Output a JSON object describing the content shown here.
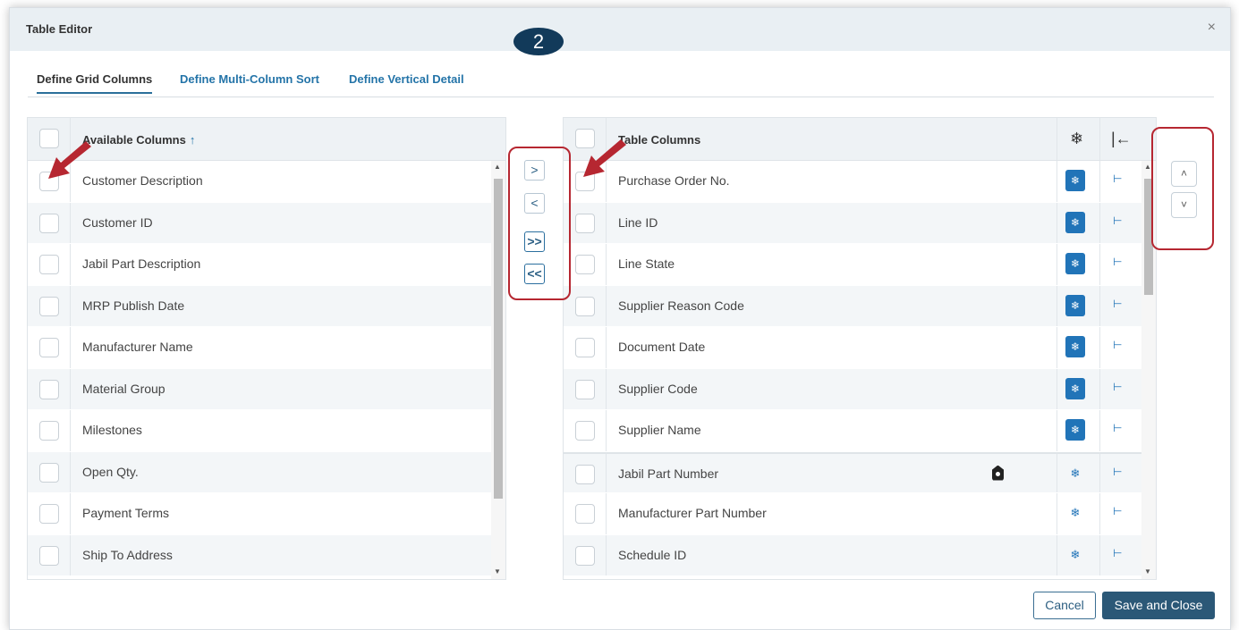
{
  "dialog": {
    "title": "Table Editor",
    "close_glyph": "×",
    "step_badge": "2"
  },
  "tabs": [
    {
      "label": "Define Grid Columns",
      "active": true
    },
    {
      "label": "Define Multi-Column Sort",
      "active": false
    },
    {
      "label": "Define Vertical Detail",
      "active": false
    }
  ],
  "available": {
    "header": "Available Columns",
    "sort_glyph": "↑",
    "items": [
      "Customer Description",
      "Customer ID",
      "Jabil Part Description",
      "MRP Publish Date",
      "Manufacturer Name",
      "Material Group",
      "Milestones",
      "Open Qty.",
      "Payment Terms",
      "Ship To Address"
    ]
  },
  "transfer": {
    "move_right": ">",
    "move_left": "<",
    "move_all_right": ">>",
    "move_all_left": "<<"
  },
  "table_columns": {
    "header": "Table Columns",
    "freeze_header_icon": "snowflake-icon",
    "pin_header_icon": "pin-left-icon",
    "freeze_glyph": "❄",
    "pin_glyph": "⊢",
    "items": [
      {
        "label": "Purchase Order No.",
        "frozen": true
      },
      {
        "label": "Line ID",
        "frozen": true
      },
      {
        "label": "Line State",
        "frozen": true
      },
      {
        "label": "Supplier Reason Code",
        "frozen": true
      },
      {
        "label": "Document Date",
        "frozen": true
      },
      {
        "label": "Supplier Code",
        "frozen": true
      },
      {
        "label": "Supplier Name",
        "frozen": true
      },
      {
        "label": "Jabil Part Number",
        "frozen": false,
        "locked": true
      },
      {
        "label": "Manufacturer Part Number",
        "frozen": false
      },
      {
        "label": "Schedule ID",
        "frozen": false
      }
    ]
  },
  "order": {
    "up": "˄",
    "down": "˅"
  },
  "footer": {
    "cancel_label": "Cancel",
    "save_label": "Save and Close"
  },
  "colors": {
    "accent": "#2174b8",
    "primary_button": "#2b5877",
    "annotation_red": "#b62731",
    "badge": "#123a5a"
  }
}
